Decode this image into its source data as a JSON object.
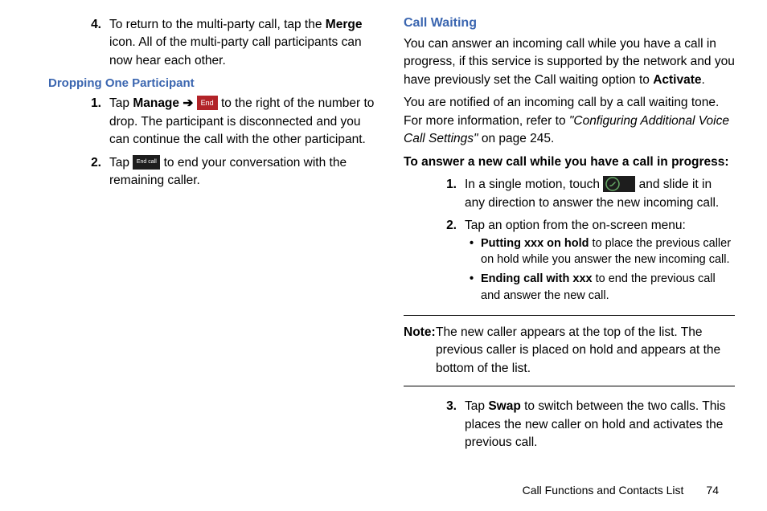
{
  "left": {
    "step4_pre": "To return to the multi-party call, tap the ",
    "step4_bold": "Merge",
    "step4_post": " icon. All of the multi-party call participants can now hear each other.",
    "h_drop": "Dropping One Participant",
    "d1_pre": "Tap ",
    "d1_bold": "Manage",
    "d1_arrow": " ➔ ",
    "d1_icon": "End",
    "d1_post": " to the right of the number to drop. The participant is disconnected and you can continue the call with the other participant.",
    "d2_pre": "Tap ",
    "d2_icon": "End call",
    "d2_post": " to end your conversation with the remaining caller."
  },
  "right": {
    "h_cw": "Call Waiting",
    "p1_pre": "You can answer an incoming call while you have a call in progress, if this service is supported by the network and you have previously set the Call waiting option to ",
    "p1_bold": "Activate",
    "p1_post": ".",
    "p2_pre": "You are notified of an incoming call by a call waiting tone. For more information, refer to ",
    "p2_italic": "\"Configuring Additional Voice Call Settings\"",
    "p2_post": "  on page 245.",
    "h_ans": "To answer a new call while you have a call in progress:",
    "a1_pre": "In a single motion, touch ",
    "a1_post": " and slide it in any direction to answer the new incoming call.",
    "a2": "Tap an option from the on-screen menu:",
    "b1_bold": "Putting xxx on hold",
    "b1_rest": " to place the previous caller on hold while you answer the new incoming call.",
    "b2_bold": "Ending call with xxx",
    "b2_rest": " to end the previous call and answer the new call.",
    "note_label": "Note:",
    "note_body": " The new caller appears at the top of the list. The previous caller is placed on hold and appears at the bottom of the list.",
    "a3_pre": "Tap ",
    "a3_bold": "Swap",
    "a3_post": " to switch between the two calls. This places the new caller on hold and activates the previous call."
  },
  "footer": {
    "section": "Call Functions and Contacts List",
    "page": "74"
  },
  "nums": {
    "n1": "1.",
    "n2": "2.",
    "n3": "3.",
    "n4": "4.",
    "bul": "•"
  }
}
